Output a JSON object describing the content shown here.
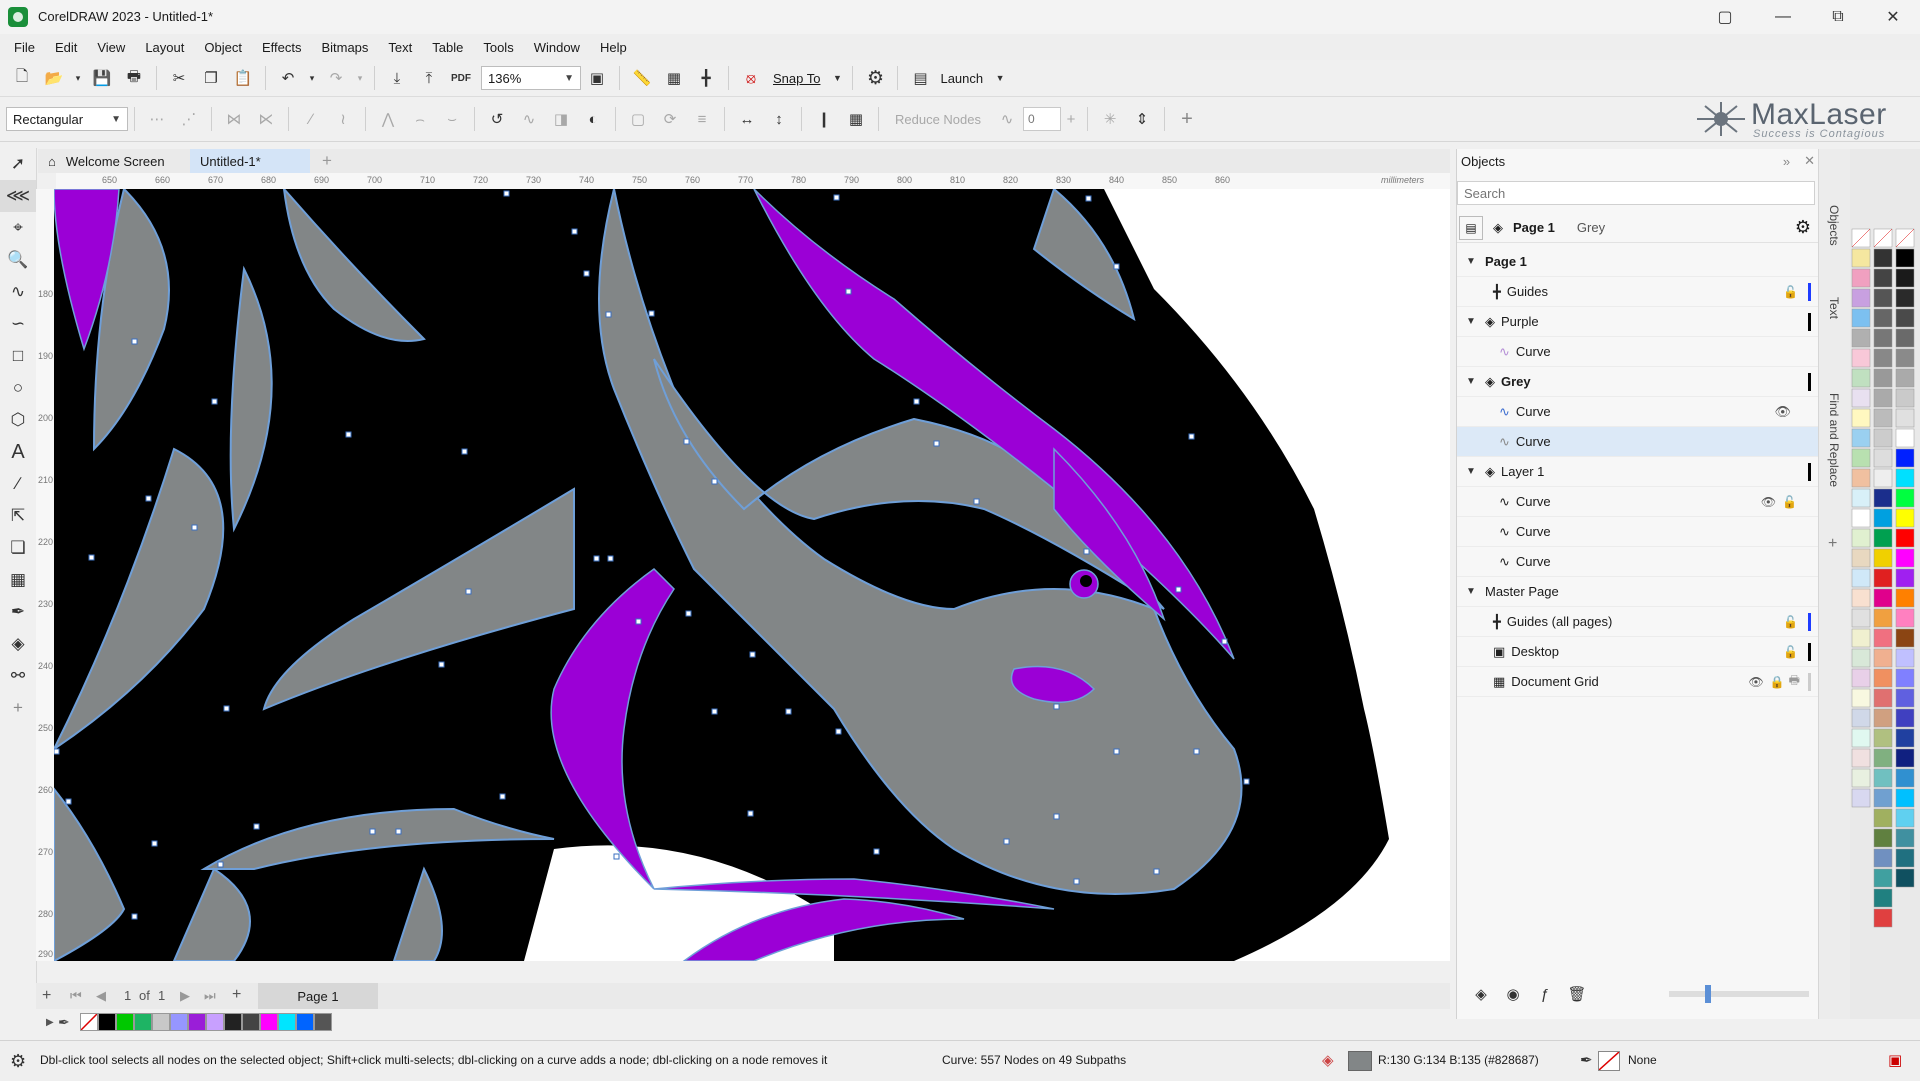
{
  "window": {
    "title": "CorelDRAW 2023 - Untitled-1*"
  },
  "menu": [
    "File",
    "Edit",
    "View",
    "Layout",
    "Object",
    "Effects",
    "Bitmaps",
    "Text",
    "Table",
    "Tools",
    "Window",
    "Help"
  ],
  "toolbar": {
    "zoom": "136%",
    "snap_label": "Snap To",
    "launch_label": "Launch",
    "pdf_label": "PDF"
  },
  "property_bar": {
    "shape_mode": "Rectangular",
    "reduce_nodes_label": "Reduce Nodes",
    "smoothing": "0"
  },
  "logo": {
    "brand": "MaxLaser",
    "tagline": "Success is Contagious"
  },
  "tabs": {
    "welcome": "Welcome Screen",
    "document": "Untitled-1*"
  },
  "ruler": {
    "units": "millimeters",
    "h_ticks": [
      "650",
      "660",
      "670",
      "680",
      "690",
      "700",
      "710",
      "720",
      "730",
      "740",
      "750",
      "760",
      "770",
      "780",
      "790",
      "800",
      "810",
      "820",
      "830",
      "840",
      "850",
      "860"
    ],
    "v_ticks": [
      "180",
      "190",
      "200",
      "210",
      "220",
      "230",
      "240",
      "250",
      "260",
      "270",
      "280",
      "290"
    ]
  },
  "page_nav": {
    "position": "1",
    "of_label": "of",
    "total": "1",
    "page_tab": "Page 1"
  },
  "swatch_colors": [
    "#000000",
    "#00c800",
    "#1eb464",
    "#c8c8c8",
    "#9696ff",
    "#9a1ed8",
    "#c8a0ff",
    "#222222",
    "#444444",
    "#00e5ff",
    "#0064ff",
    "#ff00ff",
    "#555555"
  ],
  "status": {
    "hint": "Dbl-click tool selects all nodes on the selected object; Shift+click multi-selects; dbl-clicking on a curve adds a node; dbl-clicking on a node removes it",
    "object_info": "Curve: 557 Nodes on 49 Subpaths",
    "fill_info": "R:130 G:134 B:135 (#828687)",
    "outline_info": "None"
  },
  "objects_docker": {
    "title": "Objects",
    "search_placeholder": "Search",
    "page_label": "Page 1",
    "active_layer": "Grey",
    "side_tabs": [
      "Objects",
      "Text",
      "Find and Replace"
    ],
    "tree": [
      {
        "label": "Page 1",
        "level": 0,
        "bold": true
      },
      {
        "label": "Guides",
        "level": 1,
        "icon": "guides"
      },
      {
        "label": "Purple",
        "level": 1,
        "icon": "layer",
        "expand": true
      },
      {
        "label": "Curve",
        "level": 2,
        "icon": "curve-purple"
      },
      {
        "label": "Grey",
        "level": 1,
        "icon": "layer",
        "bold": true,
        "expand": true
      },
      {
        "label": "Curve",
        "level": 2,
        "icon": "curve-blue"
      },
      {
        "label": "Curve",
        "level": 2,
        "icon": "curve-grey",
        "selected": true
      },
      {
        "label": "Layer 1",
        "level": 1,
        "icon": "layer",
        "expand": true
      },
      {
        "label": "Curve",
        "level": 2,
        "icon": "curve-black"
      },
      {
        "label": "Curve",
        "level": 2,
        "icon": "curve-black"
      },
      {
        "label": "Curve",
        "level": 2,
        "icon": "curve-black"
      },
      {
        "label": "Master Page",
        "level": 0
      },
      {
        "label": "Guides (all pages)",
        "level": 1,
        "icon": "guides"
      },
      {
        "label": "Desktop",
        "level": 1,
        "icon": "desktop"
      },
      {
        "label": "Document Grid",
        "level": 1,
        "icon": "grid"
      }
    ]
  },
  "colors": {
    "purple": "#9b00d6",
    "grey": "#828687",
    "black": "#000000",
    "outline": "#6f9fd8"
  }
}
